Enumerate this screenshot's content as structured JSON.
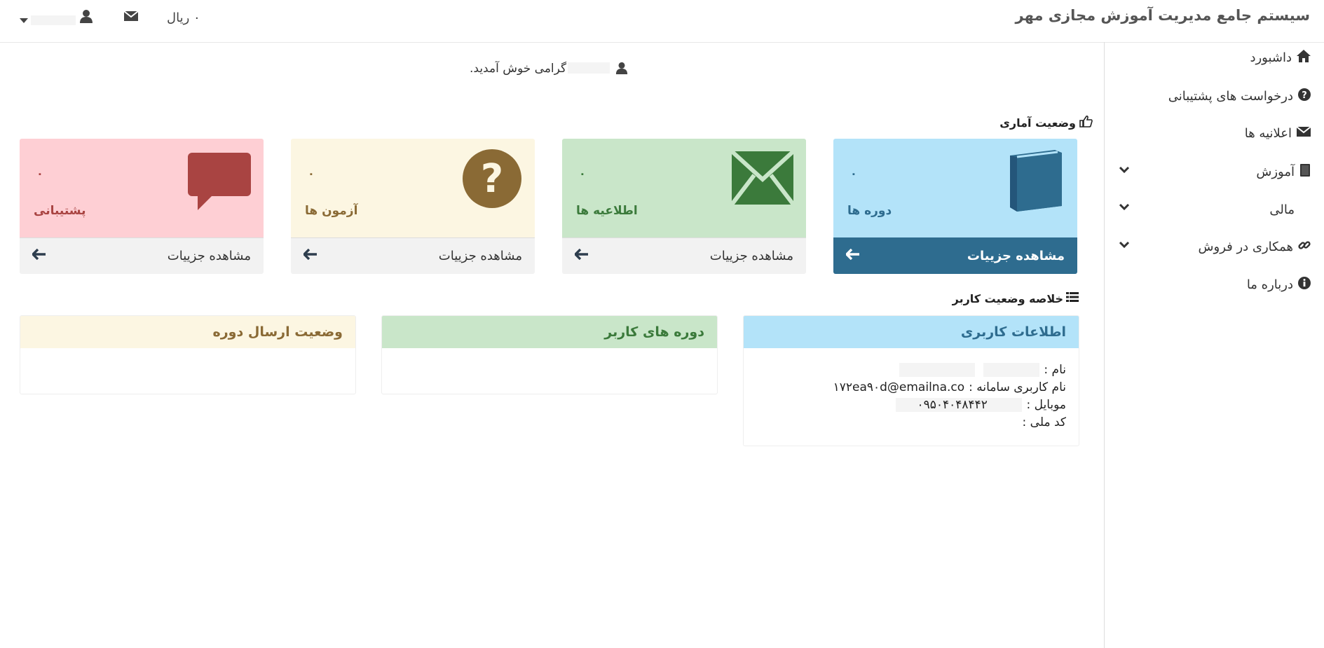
{
  "app": {
    "title": "سیستم جامع مدیریت آموزش مجازی مهر"
  },
  "topbar": {
    "balance": "۰ ریال",
    "currency_icon": "euro-icon",
    "mail_icon": "envelope-icon",
    "user_icon": "user-icon"
  },
  "sidebar": {
    "items": [
      {
        "label": "داشبورد",
        "icon": "home-icon"
      },
      {
        "label": "درخواست های پشتیبانی",
        "icon": "question-circle-icon"
      },
      {
        "label": "اعلانیه ها",
        "icon": "envelope-icon"
      },
      {
        "label": "آموزش",
        "icon": "book-icon"
      },
      {
        "label": "مالی",
        "icon": "euro-icon"
      },
      {
        "label": "همکاری در فروش",
        "icon": "link-icon"
      },
      {
        "label": "درباره ما",
        "icon": "info-circle-icon"
      }
    ]
  },
  "welcome": {
    "text": "گرامی خوش آمدید."
  },
  "stats": {
    "title": "وضعیت آماری",
    "cards": [
      {
        "label": "دوره ها",
        "count": "۰",
        "details": "مشاهده جزییات",
        "icon": "book-icon",
        "top_bg": "#b3e3f9",
        "fg": "#2e6c8f",
        "foot_bg": "#2e6c8f",
        "foot_fg": "#ffffff"
      },
      {
        "label": "اطلاعیه ها",
        "count": "۰",
        "details": "مشاهده جزییات",
        "icon": "envelope-icon",
        "top_bg": "#c9e6c9",
        "fg": "#3b7a3b",
        "foot_bg": "#f2f2f2",
        "foot_fg": "#333333"
      },
      {
        "label": "آزمون ها",
        "count": "۰",
        "details": "مشاهده جزییات",
        "icon": "question-circle-icon",
        "top_bg": "#fcf6e2",
        "fg": "#8a6a35",
        "foot_bg": "#f2f2f2",
        "foot_fg": "#333333"
      },
      {
        "label": "پشتیبانی",
        "count": "۰",
        "details": "مشاهده جزییات",
        "icon": "comment-icon",
        "top_bg": "#fecfd4",
        "fg": "#a94442",
        "foot_bg": "#f2f2f2",
        "foot_fg": "#333333"
      }
    ]
  },
  "summary": {
    "title": "خلاصه وضعیت کاربر",
    "panels": [
      {
        "title": "اطلاعات کاربری",
        "head_bg": "#b3e3f9",
        "head_fg": "#2e6c8f"
      },
      {
        "title": "دوره های کاربر",
        "head_bg": "#c9e6c9",
        "head_fg": "#3b7a3b"
      },
      {
        "title": "وضعیت ارسال دوره",
        "head_bg": "#fcf6e2",
        "head_fg": "#8a6a35"
      }
    ],
    "user_info": {
      "name_label": "نام :",
      "username_label": "نام کاربری سامانه :",
      "username_value": "۱۷۲ea۹۰d@emailna.co",
      "mobile_label": "موبایل :",
      "mobile_value": "۰۹۵۰۴۰۴۸۴۴۲",
      "national_id_label": "کد ملی :"
    }
  }
}
